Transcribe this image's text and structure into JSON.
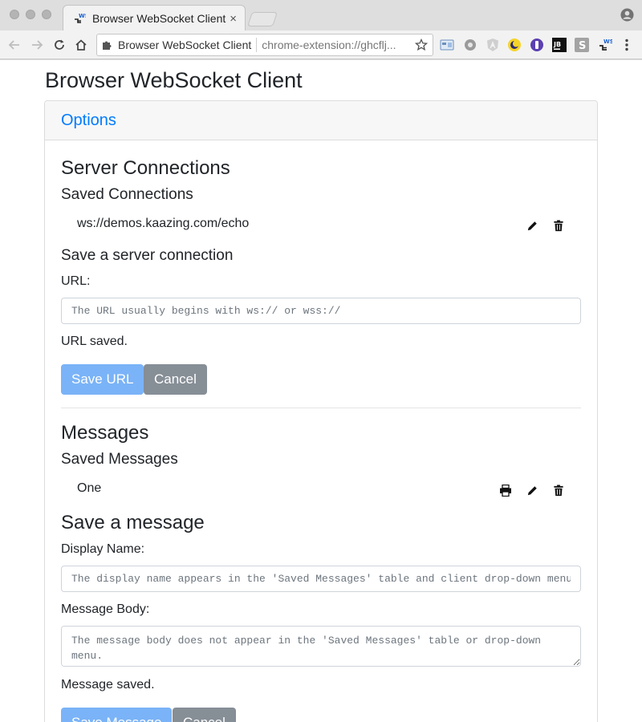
{
  "browser": {
    "tab_title": "Browser WebSocket Client",
    "tab_favicon_text": "WS",
    "tab_close": "×",
    "omnibox_title": "Browser WebSocket Client",
    "omnibox_url": "chrome-extension://ghcflj...",
    "extensions": [
      "screen-extension-icon",
      "settings-extension-icon",
      "angular-extension-icon",
      "moon-extension-icon",
      "purple-extension-icon",
      "jetbrains-extension-icon",
      "s-extension-icon",
      "websocket-extension-icon"
    ],
    "ext_jb_text": "JB",
    "ext_s_text": "S",
    "ext_ws_text": "WS"
  },
  "page": {
    "title": "Browser WebSocket Client",
    "card_header": "Options"
  },
  "servers": {
    "heading": "Server Connections",
    "saved_heading": "Saved Connections",
    "saved_items": [
      "ws://demos.kaazing.com/echo"
    ],
    "form_heading": "Save a server connection",
    "url_label": "URL:",
    "url_placeholder": "The URL usually begins with ws:// or wss://",
    "url_status": "URL saved.",
    "save_label": "Save URL",
    "cancel_label": "Cancel"
  },
  "messages": {
    "heading": "Messages",
    "saved_heading": "Saved Messages",
    "saved_items": [
      "One"
    ],
    "form_heading": "Save a message",
    "name_label": "Display Name:",
    "name_placeholder": "The display name appears in the 'Saved Messages' table and client drop-down menu",
    "body_label": "Message Body:",
    "body_placeholder": "The message body does not appear in the 'Saved Messages' table or drop-down menu.",
    "status": "Message saved.",
    "save_label": "Save Message",
    "cancel_label": "Cancel"
  },
  "colors": {
    "link": "#007bff",
    "primary_button": "#7ab3f7",
    "secondary_button": "#868e96",
    "chrome": "#dedede"
  }
}
